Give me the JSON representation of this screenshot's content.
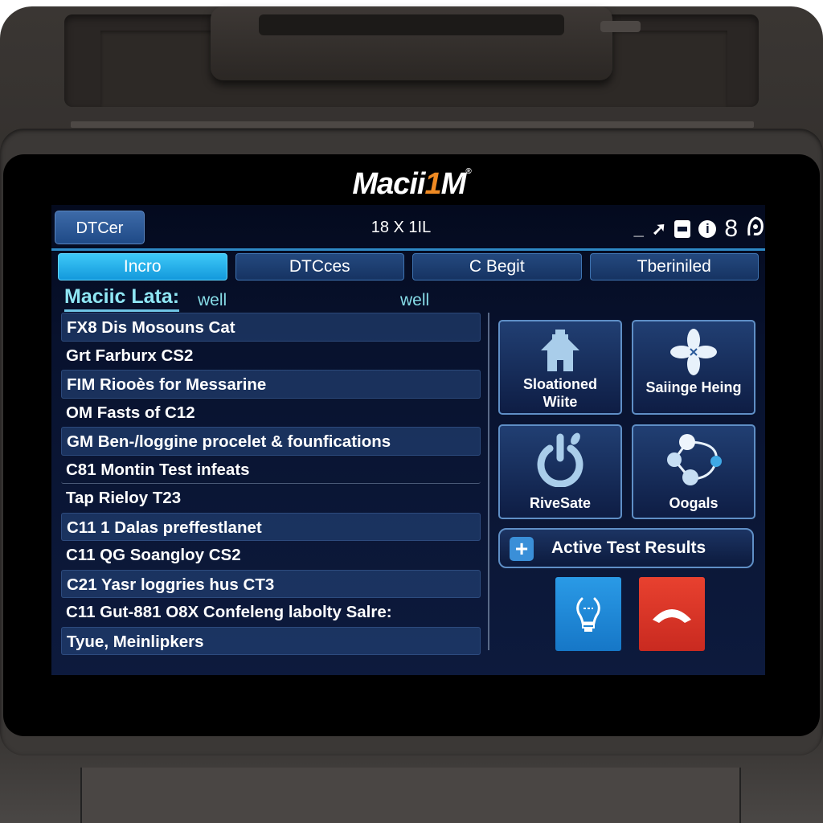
{
  "device": {
    "brand_logo": {
      "prefix": "Macii",
      "accent": "1",
      "suffix": "M",
      "mark": "®"
    },
    "brand_accent_color": "#ef8a23"
  },
  "status_bar": {
    "left_button": "DTCer",
    "center_text": "18 X 1IL",
    "icons": [
      "minimize-icon",
      "share-arrow-icon",
      "battery-icon",
      "info-icon",
      "signal-icon"
    ],
    "right_text": "8"
  },
  "tabs": [
    {
      "label": "Incro",
      "active": true
    },
    {
      "label": "DTCces",
      "active": false
    },
    {
      "label": "C Begit",
      "active": false
    },
    {
      "label": "Tberiniled",
      "active": false
    }
  ],
  "section": {
    "title": "Maciic Lata:",
    "value_1": "well",
    "value_2": "well"
  },
  "list_items": [
    "FX8 Dis Mosouns Cat",
    "Grt Farburx CS2",
    "FIM Riooès for Messarine",
    "OM Fasts of C12",
    "GM Ben-/loggine procelet & founfications",
    "C81 Montin Test infeats",
    "Tap Rieloy T23",
    "C11 1 Dalas preffestlanet",
    "C11  QG Soangloy CS2",
    "C21  Yasr loggries hus CT3",
    "C11  Gut-881 O8X Confeleng labolty Salre:",
    "Tyue, Meinlipkers"
  ],
  "tiles": [
    {
      "label_line1": "Sloationed",
      "label_line2": "Wiite",
      "icon": "house-icon"
    },
    {
      "label_line1": "Saiinge Heing",
      "label_line2": "",
      "icon": "clover-icon"
    },
    {
      "label_line1": "RiveSate",
      "label_line2": "",
      "icon": "power-icon"
    },
    {
      "label_line1": "Oogals",
      "label_line2": "",
      "icon": "network-nodes-icon"
    }
  ],
  "active_test_results": {
    "label": "Active Test Results",
    "icon": "plus-icon"
  },
  "action_buttons": [
    {
      "icon": "lightbulb-icon",
      "color": "#1f88d8"
    },
    {
      "icon": "hang-up-icon",
      "color": "#dc3627"
    }
  ],
  "colors": {
    "screen_bg": "#08122e",
    "active_tab": "#29b4ee",
    "section_title": "#8fe6f4"
  }
}
